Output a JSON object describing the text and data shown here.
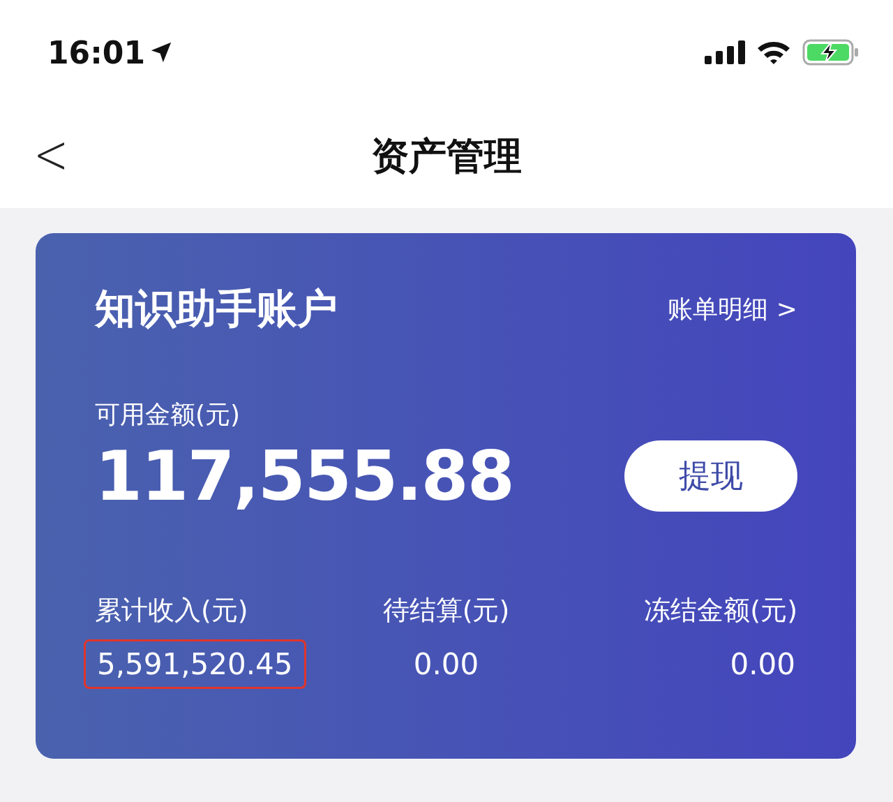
{
  "status_bar": {
    "time": "16:01",
    "location_active": true
  },
  "nav": {
    "back": "<",
    "title": "资产管理"
  },
  "account": {
    "title": "知识助手账户",
    "bill_link": "账单明细 >",
    "available_label": "可用金额(元)",
    "available_amount": "117,555.88",
    "withdraw_button": "提现",
    "stats": [
      {
        "label": "累计收入(元)",
        "value": "5,591,520.45",
        "highlighted": true
      },
      {
        "label": "待结算(元)",
        "value": "0.00",
        "highlighted": false
      },
      {
        "label": "冻结金额(元)",
        "value": "0.00",
        "highlighted": false
      }
    ]
  }
}
